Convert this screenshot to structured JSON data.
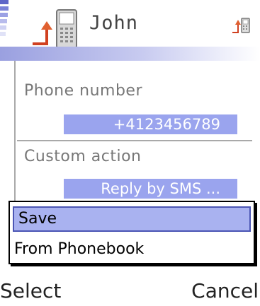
{
  "header": {
    "title": "John",
    "icons": [
      "signal-strength-icon",
      "antenna-icon",
      "contact-phone-icon",
      "small-phone-icon"
    ]
  },
  "fields": [
    {
      "label": "Phone number",
      "value": "+4123456789"
    },
    {
      "label": "Custom action",
      "value": "Reply by SMS ..."
    }
  ],
  "menu": {
    "items": [
      {
        "label": "Save",
        "selected": true
      },
      {
        "label": "From Phonebook",
        "selected": false
      }
    ]
  },
  "softkeys": {
    "left": "Select",
    "right": "Cancel"
  },
  "colors": {
    "highlight": "#9aa4ee",
    "selected_item": "#a9b2f0",
    "separator": "#a9a9a9"
  }
}
